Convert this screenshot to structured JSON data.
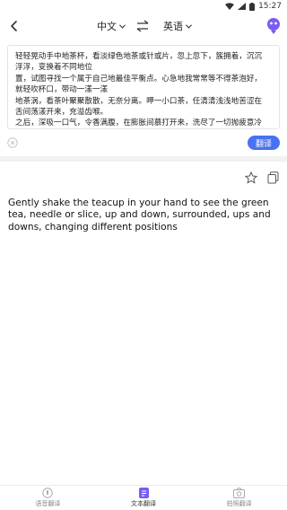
{
  "status_bar": {
    "time": "15:27"
  },
  "header": {
    "source_language": "中文",
    "target_language": "英语",
    "swap_icon": "swap-arrows-icon",
    "mascot_icon": "mascot-icon"
  },
  "input": {
    "lines": [
      "轻轻晃动手中地茶杯，看淡绿色地茶或针或片，忽上忽下，簇拥着，沉沉",
      "浮浮，变换着不同地位",
      "置，试图寻找一个属于自己地最佳平衡点。心急地我常常等不得茶泡好，",
      "就轻吹杯口，带动一漾一漾",
      "地茶涡，看茶叶聚聚散散，无奈分离。呷一小口茶，任清清浅浅地苦涩在",
      "舌间荡漾开来，充溢齿喉。",
      "之后，深吸一口气，令香满腹，在膨胀间慕打开来，洗尽了一切抛疲意冷"
    ],
    "clear_icon": "clear-icon",
    "translate_button": "翻译"
  },
  "result": {
    "text": "Gently shake the teacup in your hand to see the green tea, needle or slice, up and down, surrounded, ups and downs, changing different positions",
    "star_icon": "star-icon",
    "copy_icon": "copy-icon"
  },
  "nav": {
    "items": [
      {
        "label": "语音翻译",
        "icon": "microphone-icon",
        "active": false
      },
      {
        "label": "文本翻译",
        "icon": "document-icon",
        "active": true
      },
      {
        "label": "拍照翻译",
        "icon": "camera-icon",
        "active": false
      }
    ]
  },
  "colors": {
    "accent": "#4a72f0",
    "mascot": "#7b5cf5"
  }
}
